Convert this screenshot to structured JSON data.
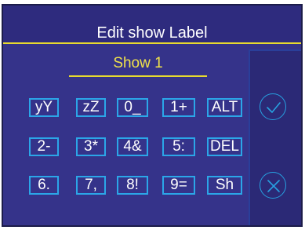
{
  "header": {
    "title": "Edit show Label"
  },
  "editor": {
    "value": "Show 1"
  },
  "keypad": {
    "row1": [
      "yY",
      "zZ",
      "0_",
      "1+",
      "ALT"
    ],
    "row2": [
      "2-",
      "3*",
      "4&",
      "5:",
      "DEL"
    ],
    "row3": [
      "6.",
      "7,",
      "8!",
      "9=",
      "Sh"
    ]
  },
  "side_buttons": {
    "confirm_icon": "checkmark-circle-icon",
    "cancel_icon": "x-circle-icon"
  },
  "colors": {
    "background": "#35338a",
    "header_line": "#e7da2f",
    "label_text": "#f0e24a",
    "key_border": "#2ba6e8",
    "icon_stroke": "#27a0e0"
  }
}
